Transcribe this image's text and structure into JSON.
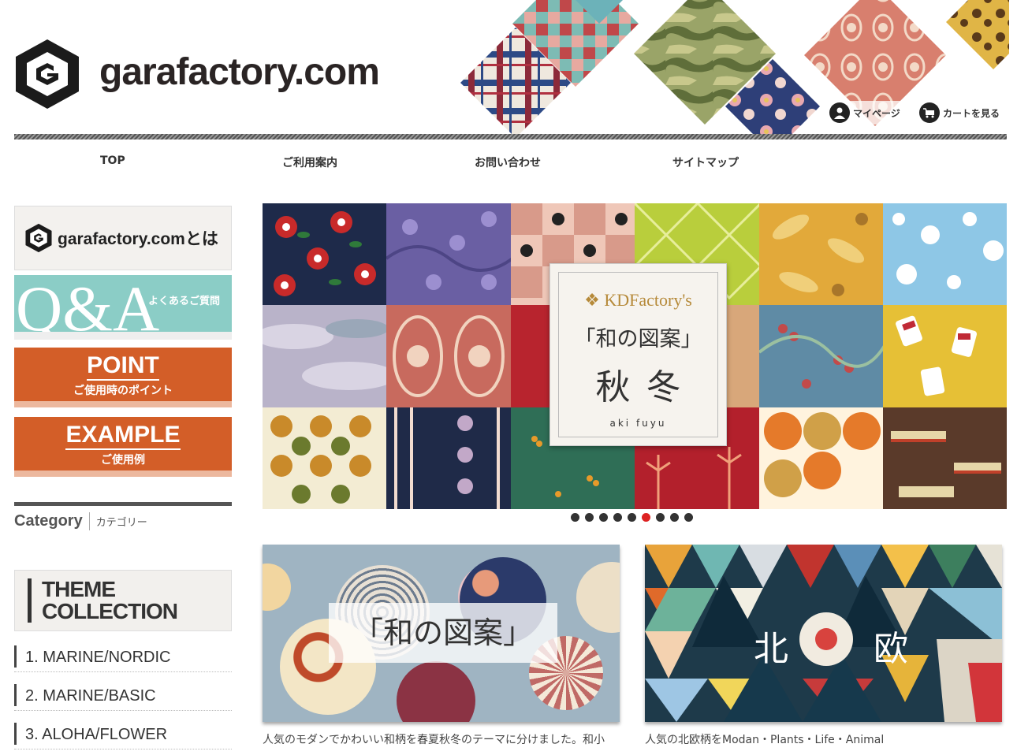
{
  "header": {
    "site_name": "garafactory.com",
    "my_page": "マイページ",
    "cart": "カートを見る"
  },
  "nav": [
    "TOP",
    "ご利用案内",
    "お問い合わせ",
    "サイトマップ"
  ],
  "sidebar": {
    "about": "garafactory.comとは",
    "qa_big": "Q&A",
    "qa_sub": "よくあるご質問",
    "point_big": "POINT",
    "point_sub": "ご使用時のポイント",
    "example_big": "EXAMPLE",
    "example_sub": "ご使用例",
    "category_en": "Category",
    "category_jp": "カテゴリー",
    "theme_line1": "THEME",
    "theme_line2": "COLLECTION",
    "theme_items": [
      "1. MARINE/NORDIC",
      "2. MARINE/BASIC",
      "3. ALOHA/FLOWER"
    ]
  },
  "slider": {
    "brand": "KDFactory's",
    "title": "「和の図案」",
    "main": "秋冬",
    "romaji": "aki   fuyu",
    "dot_count": 9,
    "active_dot": 5
  },
  "banners": {
    "wa_label": "「和の図案」",
    "wa_desc": "人気のモダンでかわいい和柄を春夏秋冬のテーマに分けました。和小",
    "hoku_left": "北",
    "hoku_right": "欧",
    "hoku_desc": "人気の北欧柄をModan・Plants・Life・Animal"
  },
  "colors": {
    "accent_orange": "#d35e28",
    "qa_teal": "#8bcdc6",
    "active_dot": "#dd2222"
  }
}
